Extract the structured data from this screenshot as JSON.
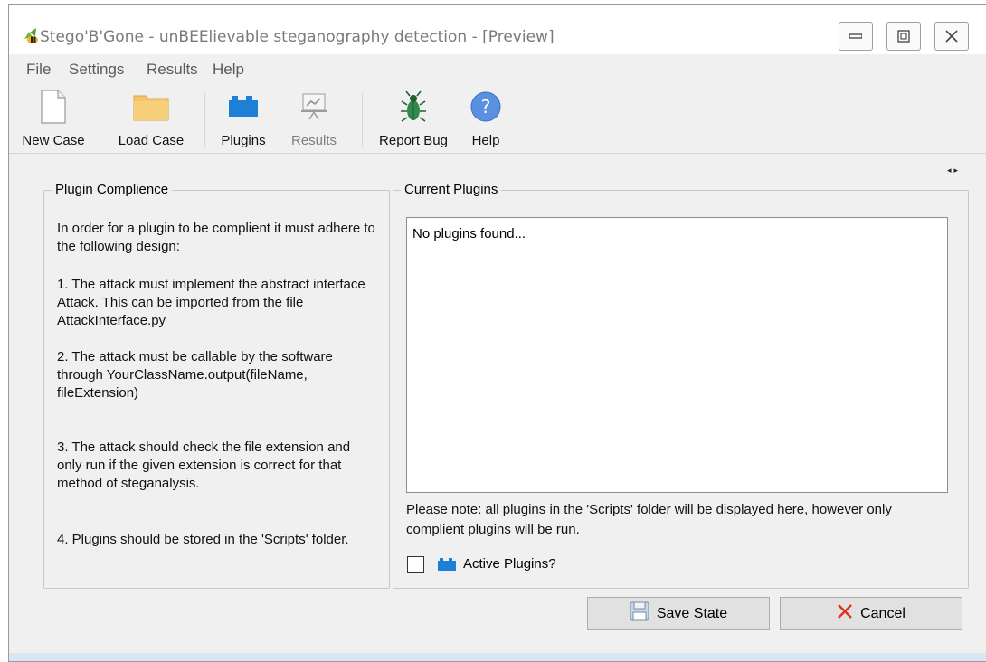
{
  "window": {
    "title": "Stego'B'Gone - unBEElievable steganography detection - [Preview]",
    "app_icon": "bee-icon",
    "controls": {
      "minimize": "minimize-icon",
      "restore": "restore-icon",
      "close": "close-icon"
    }
  },
  "menu": [
    "File",
    "Settings",
    "Results",
    "Help"
  ],
  "toolbar": {
    "new_case": "New Case",
    "load_case": "Load Case",
    "plugins": "Plugins",
    "results": "Results",
    "report_bug": "Report Bug",
    "help": "Help"
  },
  "compliance": {
    "title": "Plugin Complience",
    "intro": "In order for a plugin to be complient it must adhere to the following design:",
    "rules": [
      "1. The attack must implement the abstract interface Attack. This can be imported from the file AttackInterface.py",
      "2. The attack must be callable by the software through YourClassName.output(fileName, fileExtension)",
      "3. The attack should check the file extension and only run if the given extension is correct for that method of steganalysis.",
      "4. Plugins should be stored in the 'Scripts' folder."
    ]
  },
  "current_plugins": {
    "title": "Current Plugins",
    "empty_text": "No plugins found...",
    "note": "Please note: all plugins in the 'Scripts' folder will be displayed here, however only complient plugins will be run.",
    "active_label": "Active Plugins?",
    "active_checked": false
  },
  "buttons": {
    "save": "Save State",
    "cancel": "Cancel"
  },
  "colors": {
    "accent_blue": "#1e7fd6",
    "cancel_red": "#e0301e",
    "window_bg": "#f0f0f0"
  }
}
